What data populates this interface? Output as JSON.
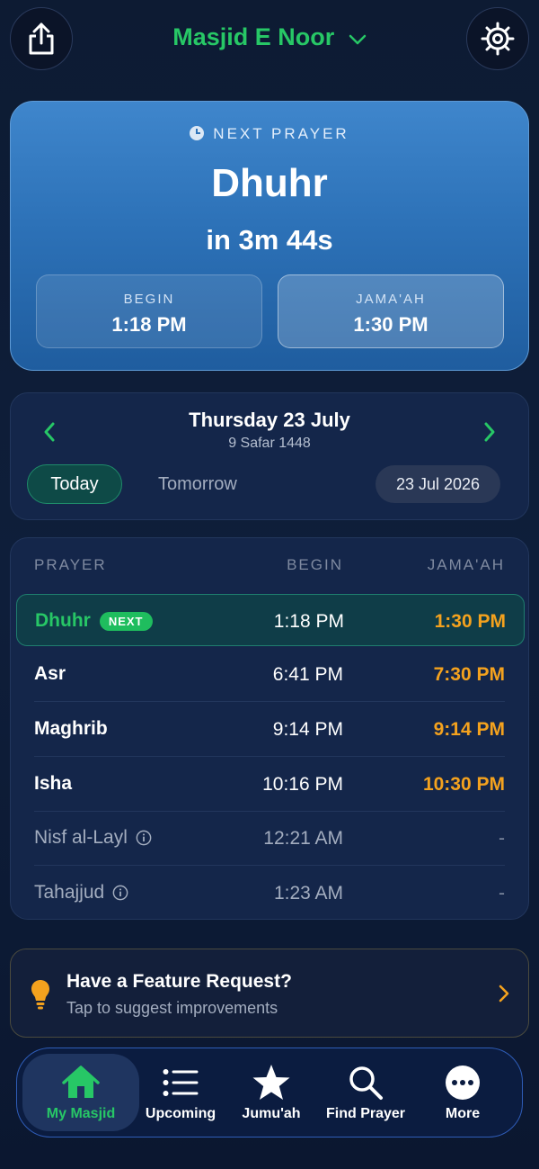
{
  "header": {
    "masjid_name": "Masjid E Noor",
    "share_icon": "share-icon",
    "settings_icon": "gear-icon"
  },
  "next_prayer": {
    "label": "NEXT PRAYER",
    "name": "Dhuhr",
    "countdown": "in 3m 44s",
    "begin_label": "BEGIN",
    "begin_time": "1:18 PM",
    "jamaah_label": "JAMA'AH",
    "jamaah_time": "1:30 PM"
  },
  "date_nav": {
    "gregorian": "Thursday 23 July",
    "hijri": "9 Safar 1448",
    "today_label": "Today",
    "tomorrow_label": "Tomorrow",
    "selected_date": "23 Jul 2026"
  },
  "prayer_table": {
    "headers": [
      "PRAYER",
      "BEGIN",
      "JAMA'AH"
    ],
    "next_badge": "NEXT",
    "rows": [
      {
        "name": "Dhuhr",
        "begin": "1:18 PM",
        "jamaah": "1:30 PM"
      },
      {
        "name": "Asr",
        "begin": "6:41 PM",
        "jamaah": "7:30 PM"
      },
      {
        "name": "Maghrib",
        "begin": "9:14 PM",
        "jamaah": "9:14 PM"
      },
      {
        "name": "Isha",
        "begin": "10:16 PM",
        "jamaah": "10:30 PM"
      },
      {
        "name": "Nisf al-Layl",
        "begin": "12:21 AM",
        "jamaah": "-"
      },
      {
        "name": "Tahajjud",
        "begin": "1:23 AM",
        "jamaah": "-"
      }
    ]
  },
  "feature_request": {
    "title": "Have a Feature Request?",
    "subtitle": "Tap to suggest improvements"
  },
  "tabs": [
    {
      "label": "My Masjid",
      "icon": "home-icon",
      "active": true
    },
    {
      "label": "Upcoming",
      "icon": "list-icon"
    },
    {
      "label": "Jumu'ah",
      "icon": "star-icon"
    },
    {
      "label": "Find Prayer",
      "icon": "search-icon"
    },
    {
      "label": "More",
      "icon": "more-icon"
    }
  ],
  "colors": {
    "accent_green": "#27c766",
    "jamaah_orange": "#f4a21e",
    "background": "#0d1b33"
  }
}
